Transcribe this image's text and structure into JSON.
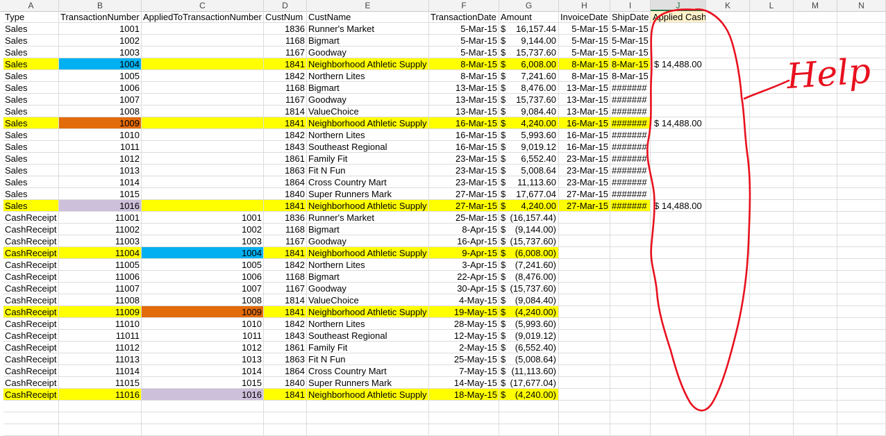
{
  "column_letters": [
    "A",
    "B",
    "C",
    "D",
    "E",
    "F",
    "G",
    "H",
    "I",
    "J",
    "K",
    "L",
    "M",
    "N"
  ],
  "header_row": {
    "type": "Type",
    "trans_num": "TransactionNumber",
    "applied_to": "AppliedToTransactionNumber",
    "cust_num": "CustNum",
    "cust_name": "CustName",
    "trans_date": "TransactionDate",
    "amount": "Amount",
    "invoice_date": "InvoiceDate",
    "ship_date": "ShipDate",
    "applied_cash": "Applied Cash"
  },
  "rows": [
    {
      "type": "Sales",
      "trans_num": "1001",
      "applied_to": "",
      "cust_num": "1836",
      "cust_name": "Runner's Market",
      "trans_date": "5-Mar-15",
      "amt_sym": "$",
      "amount": "16,157.44",
      "invoice_date": "5-Mar-15",
      "ship_date": "5-Mar-15",
      "applied_cash": ""
    },
    {
      "type": "Sales",
      "trans_num": "1002",
      "applied_to": "",
      "cust_num": "1168",
      "cust_name": "Bigmart",
      "trans_date": "5-Mar-15",
      "amt_sym": "$",
      "amount": "9,144.00",
      "invoice_date": "5-Mar-15",
      "ship_date": "5-Mar-15",
      "applied_cash": ""
    },
    {
      "type": "Sales",
      "trans_num": "1003",
      "applied_to": "",
      "cust_num": "1167",
      "cust_name": "Goodway",
      "trans_date": "5-Mar-15",
      "amt_sym": "$",
      "amount": "15,737.60",
      "invoice_date": "5-Mar-15",
      "ship_date": "5-Mar-15",
      "applied_cash": ""
    },
    {
      "type": "Sales",
      "trans_num": "1004",
      "applied_to": "",
      "cust_num": "1841",
      "cust_name": "Neighborhood Athletic Supply",
      "trans_date": "8-Mar-15",
      "amt_sym": "$",
      "amount": "6,008.00",
      "invoice_date": "8-Mar-15",
      "ship_date": "8-Mar-15",
      "applied_cash": "$ 14,488.00"
    },
    {
      "type": "Sales",
      "trans_num": "1005",
      "applied_to": "",
      "cust_num": "1842",
      "cust_name": "Northern Lites",
      "trans_date": "8-Mar-15",
      "amt_sym": "$",
      "amount": "7,241.60",
      "invoice_date": "8-Mar-15",
      "ship_date": "8-Mar-15",
      "applied_cash": ""
    },
    {
      "type": "Sales",
      "trans_num": "1006",
      "applied_to": "",
      "cust_num": "1168",
      "cust_name": "Bigmart",
      "trans_date": "13-Mar-15",
      "amt_sym": "$",
      "amount": "8,476.00",
      "invoice_date": "13-Mar-15",
      "ship_date": "#######",
      "applied_cash": ""
    },
    {
      "type": "Sales",
      "trans_num": "1007",
      "applied_to": "",
      "cust_num": "1167",
      "cust_name": "Goodway",
      "trans_date": "13-Mar-15",
      "amt_sym": "$",
      "amount": "15,737.60",
      "invoice_date": "13-Mar-15",
      "ship_date": "#######",
      "applied_cash": ""
    },
    {
      "type": "Sales",
      "trans_num": "1008",
      "applied_to": "",
      "cust_num": "1814",
      "cust_name": "ValueChoice",
      "trans_date": "13-Mar-15",
      "amt_sym": "$",
      "amount": "9,084.40",
      "invoice_date": "13-Mar-15",
      "ship_date": "#######",
      "applied_cash": ""
    },
    {
      "type": "Sales",
      "trans_num": "1009",
      "applied_to": "",
      "cust_num": "1841",
      "cust_name": "Neighborhood Athletic Supply",
      "trans_date": "16-Mar-15",
      "amt_sym": "$",
      "amount": "4,240.00",
      "invoice_date": "16-Mar-15",
      "ship_date": "#######",
      "applied_cash": "$ 14,488.00"
    },
    {
      "type": "Sales",
      "trans_num": "1010",
      "applied_to": "",
      "cust_num": "1842",
      "cust_name": "Northern Lites",
      "trans_date": "16-Mar-15",
      "amt_sym": "$",
      "amount": "5,993.60",
      "invoice_date": "16-Mar-15",
      "ship_date": "#######",
      "applied_cash": ""
    },
    {
      "type": "Sales",
      "trans_num": "1011",
      "applied_to": "",
      "cust_num": "1843",
      "cust_name": "Southeast Regional",
      "trans_date": "16-Mar-15",
      "amt_sym": "$",
      "amount": "9,019.12",
      "invoice_date": "16-Mar-15",
      "ship_date": "#######",
      "applied_cash": ""
    },
    {
      "type": "Sales",
      "trans_num": "1012",
      "applied_to": "",
      "cust_num": "1861",
      "cust_name": "Family Fit",
      "trans_date": "23-Mar-15",
      "amt_sym": "$",
      "amount": "6,552.40",
      "invoice_date": "23-Mar-15",
      "ship_date": "#######",
      "applied_cash": ""
    },
    {
      "type": "Sales",
      "trans_num": "1013",
      "applied_to": "",
      "cust_num": "1863",
      "cust_name": "Fit N Fun",
      "trans_date": "23-Mar-15",
      "amt_sym": "$",
      "amount": "5,008.64",
      "invoice_date": "23-Mar-15",
      "ship_date": "#######",
      "applied_cash": ""
    },
    {
      "type": "Sales",
      "trans_num": "1014",
      "applied_to": "",
      "cust_num": "1864",
      "cust_name": "Cross Country Mart",
      "trans_date": "23-Mar-15",
      "amt_sym": "$",
      "amount": "11,113.60",
      "invoice_date": "23-Mar-15",
      "ship_date": "#######",
      "applied_cash": ""
    },
    {
      "type": "Sales",
      "trans_num": "1015",
      "applied_to": "",
      "cust_num": "1840",
      "cust_name": "Super Runners Mark",
      "trans_date": "27-Mar-15",
      "amt_sym": "$",
      "amount": "17,677.04",
      "invoice_date": "27-Mar-15",
      "ship_date": "#######",
      "applied_cash": ""
    },
    {
      "type": "Sales",
      "trans_num": "1016",
      "applied_to": "",
      "cust_num": "1841",
      "cust_name": "Neighborhood Athletic Supply",
      "trans_date": "27-Mar-15",
      "amt_sym": "$",
      "amount": "4,240.00",
      "invoice_date": "27-Mar-15",
      "ship_date": "#######",
      "applied_cash": "$ 14,488.00"
    },
    {
      "type": "CashReceipt",
      "trans_num": "11001",
      "applied_to": "1001",
      "cust_num": "1836",
      "cust_name": "Runner's Market",
      "trans_date": "25-Mar-15",
      "amt_sym": "$",
      "amount": "(16,157.44)",
      "invoice_date": "",
      "ship_date": "",
      "applied_cash": ""
    },
    {
      "type": "CashReceipt",
      "trans_num": "11002",
      "applied_to": "1002",
      "cust_num": "1168",
      "cust_name": "Bigmart",
      "trans_date": "8-Apr-15",
      "amt_sym": "$",
      "amount": "(9,144.00)",
      "invoice_date": "",
      "ship_date": "",
      "applied_cash": ""
    },
    {
      "type": "CashReceipt",
      "trans_num": "11003",
      "applied_to": "1003",
      "cust_num": "1167",
      "cust_name": "Goodway",
      "trans_date": "16-Apr-15",
      "amt_sym": "$",
      "amount": "(15,737.60)",
      "invoice_date": "",
      "ship_date": "",
      "applied_cash": ""
    },
    {
      "type": "CashReceipt",
      "trans_num": "11004",
      "applied_to": "1004",
      "cust_num": "1841",
      "cust_name": "Neighborhood Athletic Supply",
      "trans_date": "9-Apr-15",
      "amt_sym": "$",
      "amount": "(6,008.00)",
      "invoice_date": "",
      "ship_date": "",
      "applied_cash": ""
    },
    {
      "type": "CashReceipt",
      "trans_num": "11005",
      "applied_to": "1005",
      "cust_num": "1842",
      "cust_name": "Northern Lites",
      "trans_date": "3-Apr-15",
      "amt_sym": "$",
      "amount": "(7,241.60)",
      "invoice_date": "",
      "ship_date": "",
      "applied_cash": ""
    },
    {
      "type": "CashReceipt",
      "trans_num": "11006",
      "applied_to": "1006",
      "cust_num": "1168",
      "cust_name": "Bigmart",
      "trans_date": "22-Apr-15",
      "amt_sym": "$",
      "amount": "(8,476.00)",
      "invoice_date": "",
      "ship_date": "",
      "applied_cash": ""
    },
    {
      "type": "CashReceipt",
      "trans_num": "11007",
      "applied_to": "1007",
      "cust_num": "1167",
      "cust_name": "Goodway",
      "trans_date": "30-Apr-15",
      "amt_sym": "$",
      "amount": "(15,737.60)",
      "invoice_date": "",
      "ship_date": "",
      "applied_cash": ""
    },
    {
      "type": "CashReceipt",
      "trans_num": "11008",
      "applied_to": "1008",
      "cust_num": "1814",
      "cust_name": "ValueChoice",
      "trans_date": "4-May-15",
      "amt_sym": "$",
      "amount": "(9,084.40)",
      "invoice_date": "",
      "ship_date": "",
      "applied_cash": ""
    },
    {
      "type": "CashReceipt",
      "trans_num": "11009",
      "applied_to": "1009",
      "cust_num": "1841",
      "cust_name": "Neighborhood Athletic Supply",
      "trans_date": "19-May-15",
      "amt_sym": "$",
      "amount": "(4,240.00)",
      "invoice_date": "",
      "ship_date": "",
      "applied_cash": ""
    },
    {
      "type": "CashReceipt",
      "trans_num": "11010",
      "applied_to": "1010",
      "cust_num": "1842",
      "cust_name": "Northern Lites",
      "trans_date": "28-May-15",
      "amt_sym": "$",
      "amount": "(5,993.60)",
      "invoice_date": "",
      "ship_date": "",
      "applied_cash": ""
    },
    {
      "type": "CashReceipt",
      "trans_num": "11011",
      "applied_to": "1011",
      "cust_num": "1843",
      "cust_name": "Southeast Regional",
      "trans_date": "12-May-15",
      "amt_sym": "$",
      "amount": "(9,019.12)",
      "invoice_date": "",
      "ship_date": "",
      "applied_cash": ""
    },
    {
      "type": "CashReceipt",
      "trans_num": "11012",
      "applied_to": "1012",
      "cust_num": "1861",
      "cust_name": "Family Fit",
      "trans_date": "2-May-15",
      "amt_sym": "$",
      "amount": "(6,552.40)",
      "invoice_date": "",
      "ship_date": "",
      "applied_cash": ""
    },
    {
      "type": "CashReceipt",
      "trans_num": "11013",
      "applied_to": "1013",
      "cust_num": "1863",
      "cust_name": "Fit N Fun",
      "trans_date": "25-May-15",
      "amt_sym": "$",
      "amount": "(5,008.64)",
      "invoice_date": "",
      "ship_date": "",
      "applied_cash": ""
    },
    {
      "type": "CashReceipt",
      "trans_num": "11014",
      "applied_to": "1014",
      "cust_num": "1864",
      "cust_name": "Cross Country Mart",
      "trans_date": "7-May-15",
      "amt_sym": "$",
      "amount": "(11,113.60)",
      "invoice_date": "",
      "ship_date": "",
      "applied_cash": ""
    },
    {
      "type": "CashReceipt",
      "trans_num": "11015",
      "applied_to": "1015",
      "cust_num": "1840",
      "cust_name": "Super Runners Mark",
      "trans_date": "14-May-15",
      "amt_sym": "$",
      "amount": "(17,677.04)",
      "invoice_date": "",
      "ship_date": "",
      "applied_cash": ""
    },
    {
      "type": "CashReceipt",
      "trans_num": "11016",
      "applied_to": "1016",
      "cust_num": "1841",
      "cust_name": "Neighborhood Athletic Supply",
      "trans_date": "18-May-15",
      "amt_sym": "$",
      "amount": "(4,240.00)",
      "invoice_date": "",
      "ship_date": "",
      "applied_cash": ""
    }
  ],
  "highlight": {
    "row_yellow": "#ffff00",
    "cell_1004": "#00b0f0",
    "cell_1009": "#e26b0a",
    "cell_1016": "#ccc0da",
    "header_J": "#fff2cc",
    "annotation": "#e8101e"
  },
  "annotation_text": "Help"
}
